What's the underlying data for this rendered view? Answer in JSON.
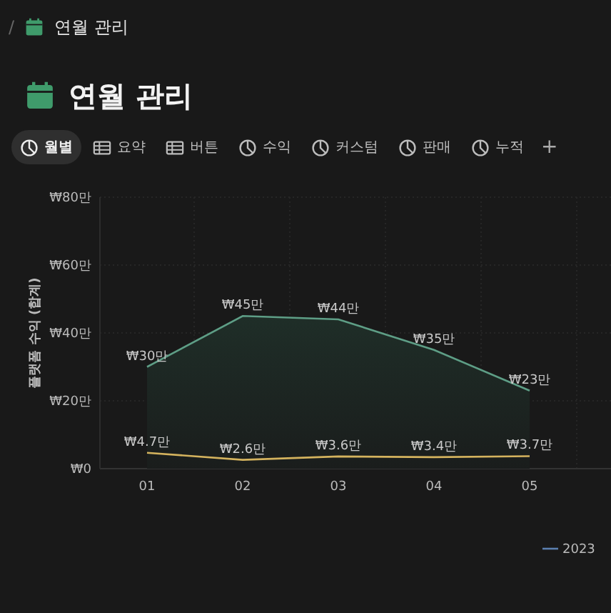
{
  "breadcrumb": {
    "separator": "/",
    "label": "연월 관리"
  },
  "title": "연월 관리",
  "tabs": [
    {
      "label": "월별",
      "kind": "chart",
      "selected": true
    },
    {
      "label": "요약",
      "kind": "table",
      "selected": false
    },
    {
      "label": "버튼",
      "kind": "table",
      "selected": false
    },
    {
      "label": "수익",
      "kind": "chart",
      "selected": false
    },
    {
      "label": "커스텀",
      "kind": "chart",
      "selected": false
    },
    {
      "label": "판매",
      "kind": "chart",
      "selected": false
    },
    {
      "label": "누적",
      "kind": "chart",
      "selected": false
    }
  ],
  "add_tab": "+",
  "chart": {
    "chart_data": {
      "type": "line",
      "ylabel": "플랫폼 수익 (합계)",
      "categories": [
        "01",
        "02",
        "03",
        "04",
        "05"
      ],
      "series": [
        {
          "color": "#5e9e86",
          "values": [
            30,
            45,
            44,
            35,
            23
          ],
          "value_labels": [
            "₩30만",
            "₩45만",
            "₩44만",
            "₩35만",
            "₩23만"
          ]
        },
        {
          "color": "#d4b35e",
          "values": [
            4.7,
            2.6,
            3.6,
            3.4,
            3.7
          ],
          "value_labels": [
            "₩4.7만",
            "₩2.6만",
            "₩3.6만",
            "₩3.4만",
            "₩3.7만"
          ]
        }
      ],
      "grid": true,
      "ylim": [
        0,
        80
      ],
      "yticks": [
        {
          "value": 0,
          "label": "₩0"
        },
        {
          "value": 20,
          "label": "₩20만"
        },
        {
          "value": 40,
          "label": "₩40만"
        },
        {
          "value": 60,
          "label": "₩60만"
        },
        {
          "value": 80,
          "label": "₩80만"
        }
      ],
      "data_labels": false
    },
    "legend": [
      {
        "label": "2023",
        "color": "#5b7fb0"
      }
    ]
  }
}
